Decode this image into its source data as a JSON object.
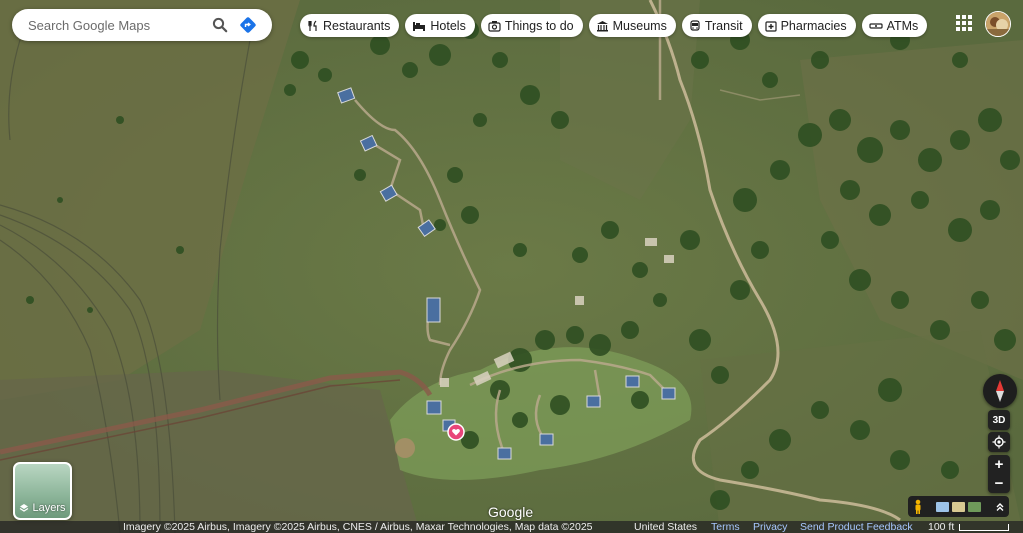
{
  "map": {
    "view": "satellite",
    "subject": "safari lodge tents in savanna",
    "colors": {
      "grass": "#556b3c",
      "dry_grass": "#6e7446",
      "bush": "#2f4f22",
      "track": "#b9a98c",
      "road": "#8a5a4a",
      "pin": "#e8457a"
    }
  },
  "search": {
    "placeholder": "Search Google Maps",
    "icons": {
      "search": "search-icon",
      "directions": "directions-icon"
    }
  },
  "chips": [
    {
      "label": "Restaurants",
      "icon": "fork-knife-icon"
    },
    {
      "label": "Hotels",
      "icon": "bed-icon"
    },
    {
      "label": "Things to do",
      "icon": "camera-icon"
    },
    {
      "label": "Museums",
      "icon": "museum-icon"
    },
    {
      "label": "Transit",
      "icon": "bus-icon"
    },
    {
      "label": "Pharmacies",
      "icon": "pharmacy-icon"
    },
    {
      "label": "ATMs",
      "icon": "atm-icon"
    }
  ],
  "layers": {
    "label": "Layers"
  },
  "controls": {
    "btn_3d": "3D",
    "zoom_in": "+",
    "zoom_out": "−"
  },
  "logo": "Google",
  "footer": {
    "attribution": "Imagery ©2025 Airbus, Imagery ©2025 Airbus, CNES / Airbus, Maxar Technologies, Map data ©2025",
    "country": "United States",
    "terms": "Terms",
    "privacy": "Privacy",
    "feedback": "Send Product Feedback",
    "scale": "100 ft"
  }
}
